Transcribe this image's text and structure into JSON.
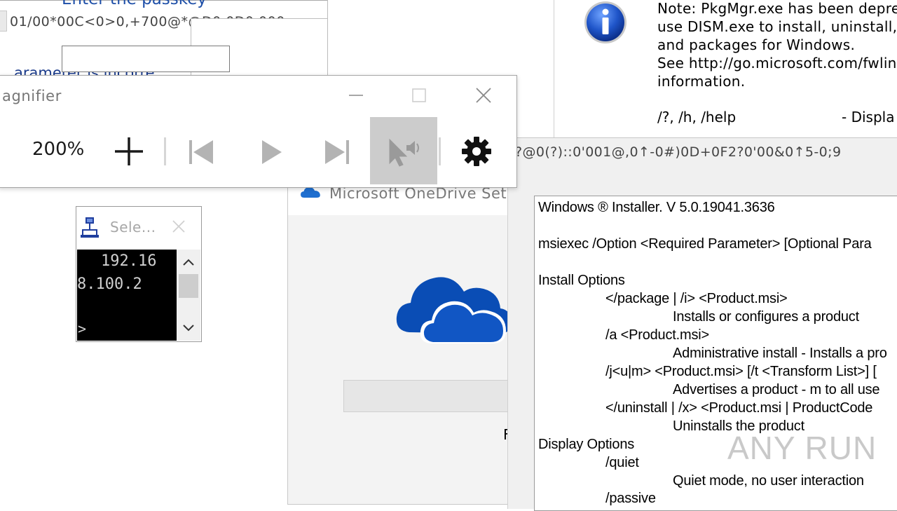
{
  "back_left": {
    "garbled_text": "01/00*00C<0>0,+700@*@D0.0D0.000",
    "partial_text": "arameter is incorre"
  },
  "passkey": {
    "title": "Enter the passkey"
  },
  "pkgmgr": {
    "note_lines": [
      "Note: PkgMgr.exe has been depre",
      "use DISM.exe to install, uninstall,",
      "and packages for Windows.",
      "See http://go.microsoft.com/fwlin",
      "information."
    ],
    "help_switch": "/?, /h, /help",
    "help_desc": "- Displa"
  },
  "garbled_strip": {
    "text": "?@0(?)::0'001@,0↑-0#)0D+0F2?0'00&0↑5-0;9"
  },
  "magnifier": {
    "title": "agnifier",
    "zoom": "200%",
    "colors": {
      "read_bg": "#cccccc",
      "icon": "#1a1a1a",
      "disabled": "#b3b3b3"
    }
  },
  "console": {
    "title": "Sele...",
    "line1": "192.16",
    "line2": "8.100.2",
    "prompt": ">"
  },
  "onedrive": {
    "title": "Microsoft OneDrive Setu",
    "peek_char": "F",
    "colors": {
      "cloud": "#0a4db5",
      "cloud_front": "#1156c4"
    }
  },
  "msiexec": {
    "lines": [
      "Windows ® Installer. V 5.0.19041.3636",
      "msiexec /Option <Required Parameter> [Optional Para",
      "Install Options",
      "</package | /i> <Product.msi>",
      "Installs or configures a product",
      "/a <Product.msi>",
      "Administrative install - Installs a pro",
      "/j<u|m> <Product.msi> [/t <Transform List>] [",
      "Advertises a product - m to all use",
      "</uninstall | /x> <Product.msi | ProductCode",
      "Uninstalls the product",
      "Display Options",
      "/quiet",
      "Quiet mode, no user interaction",
      "/passive"
    ]
  },
  "watermark": {
    "text": "ANY RUN"
  }
}
